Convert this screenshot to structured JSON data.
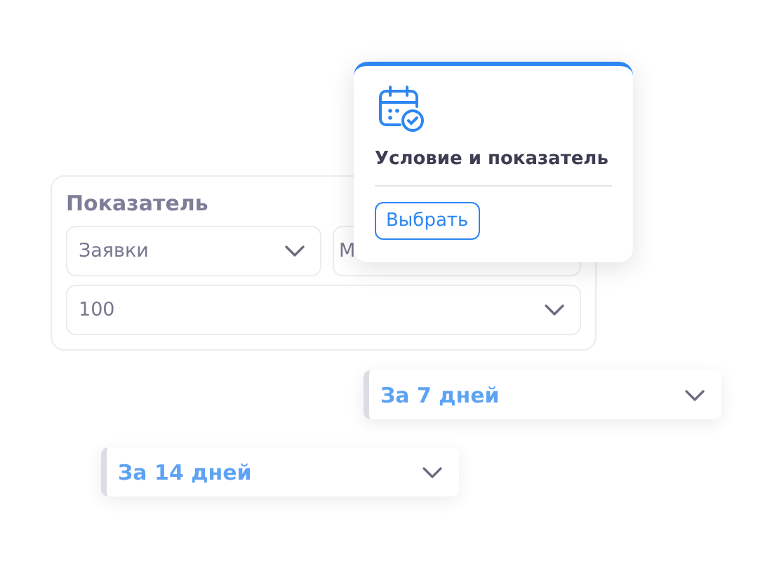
{
  "panel": {
    "title": "Показатель",
    "selects": [
      {
        "value": "Заявки"
      },
      {
        "value": "М"
      }
    ],
    "amount": {
      "value": "100"
    }
  },
  "popup": {
    "title": "Условие и показатель",
    "button": "Выбрать"
  },
  "periods": [
    {
      "value": "За 7 дней"
    },
    {
      "value": "За 14 дней"
    }
  ]
}
